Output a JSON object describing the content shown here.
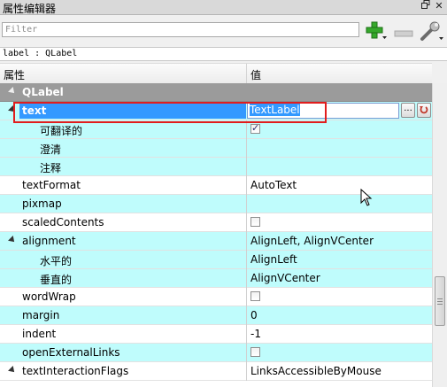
{
  "window": {
    "title": "属性编辑器",
    "float_icon": "restore-icon",
    "close_icon": "close-icon"
  },
  "filter": {
    "placeholder": "Filter",
    "value": ""
  },
  "toolbar": {
    "add_icon": "plus-icon",
    "remove_icon": "minus-icon",
    "config_icon": "wrench-icon"
  },
  "class_label": "label : QLabel",
  "columns": {
    "property": "属性",
    "value": "值"
  },
  "colors": {
    "accent_selection": "#3399ff",
    "group_row": "#9b9b9b",
    "alt_row": "#bffcfc",
    "highlight_box": "#e11d1d"
  },
  "rows": [
    {
      "name": "QLabel",
      "value": "",
      "kind": "group",
      "expanded": true
    },
    {
      "name": "text",
      "value": "TextLabel",
      "kind": "editing",
      "expanded": true
    },
    {
      "name": "可翻译的",
      "value": "",
      "kind": "checkbox",
      "checked": true
    },
    {
      "name": "澄清",
      "value": ""
    },
    {
      "name": "注释",
      "value": ""
    },
    {
      "name": "textFormat",
      "value": "AutoText"
    },
    {
      "name": "pixmap",
      "value": ""
    },
    {
      "name": "scaledContents",
      "value": "",
      "kind": "checkbox",
      "checked": false
    },
    {
      "name": "alignment",
      "value": "AlignLeft, AlignVCenter",
      "expanded": true
    },
    {
      "name": "水平的",
      "value": "AlignLeft"
    },
    {
      "name": "垂直的",
      "value": "AlignVCenter"
    },
    {
      "name": "wordWrap",
      "value": "",
      "kind": "checkbox",
      "checked": false
    },
    {
      "name": "margin",
      "value": "0"
    },
    {
      "name": "indent",
      "value": "-1"
    },
    {
      "name": "openExternalLinks",
      "value": "",
      "kind": "checkbox",
      "checked": false
    },
    {
      "name": "textInteractionFlags",
      "value": "LinksAccessibleByMouse",
      "expanded": true
    }
  ],
  "text_editor": {
    "more_button": "...",
    "reset_icon": "reset-arrow-icon"
  }
}
